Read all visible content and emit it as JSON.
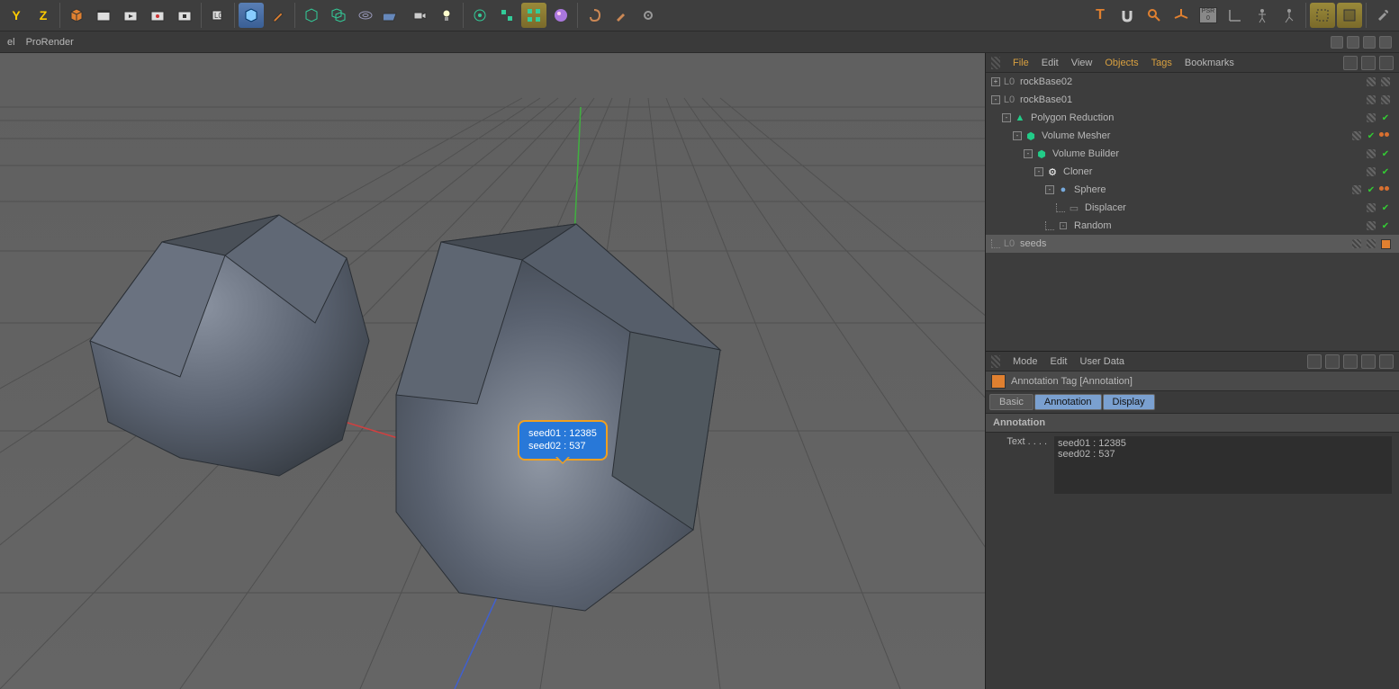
{
  "toolbar": {
    "left_icons": [
      "axis-y-icon",
      "axis-z-icon",
      "cube-icon",
      "clapper-icon",
      "clapper-play-icon",
      "clapper-rec-icon",
      "clapper-stop-icon"
    ],
    "left_icons2": [
      "layer-icon",
      "cube-shaded-icon",
      "pencil-icon",
      "cube-wireframe-add-icon",
      "cube-copy-icon",
      "torus-icon",
      "floor-icon",
      "camera-icon",
      "light-icon"
    ],
    "left_icons3": [
      "atom-icon",
      "cubes-link-icon",
      "cubes-group-icon",
      "sphere-icon",
      "spiral-icon",
      "brush-icon",
      "gear-icon"
    ],
    "right_icons": [
      "text-icon",
      "magnet-icon",
      "search-icon",
      "axis-widget-icon",
      "psr-icon",
      "coords-icon",
      "figure-icon",
      "walk-icon",
      "selection-a-icon",
      "selection-b-icon",
      "wrench-icon"
    ]
  },
  "second_bar": {
    "left": [
      "el",
      "ProRender"
    ]
  },
  "viewport": {
    "annotation": "seed01 : 12385\nseed02 : 537"
  },
  "object_manager": {
    "menu": [
      "File",
      "Edit",
      "View",
      "Objects",
      "Tags",
      "Bookmarks"
    ],
    "menu_active": [
      1,
      0,
      0,
      1,
      1,
      0
    ],
    "tree": [
      {
        "depth": 0,
        "exp": "+",
        "iconColor": "#888",
        "iconText": "L0",
        "label": "rockBase02",
        "tags": [
          "enable",
          "enable"
        ]
      },
      {
        "depth": 0,
        "exp": "-",
        "iconColor": "#888",
        "iconText": "L0",
        "label": "rockBase01",
        "tags": [
          "enable",
          "enable"
        ]
      },
      {
        "depth": 1,
        "exp": "-",
        "iconColor": "#2c8",
        "iconText": "▲",
        "label": "Polygon Reduction",
        "tags": [
          "enable",
          "check"
        ]
      },
      {
        "depth": 2,
        "exp": "-",
        "iconColor": "#2c8",
        "iconText": "⬢",
        "label": "Volume Mesher",
        "tags": [
          "enable",
          "check",
          "double"
        ]
      },
      {
        "depth": 3,
        "exp": "-",
        "iconColor": "#2c8",
        "iconText": "⬢",
        "label": "Volume Builder",
        "tags": [
          "enable",
          "check"
        ]
      },
      {
        "depth": 4,
        "exp": "-",
        "iconColor": "#fff",
        "iconText": "⚙",
        "label": "Cloner",
        "tags": [
          "enable",
          "check"
        ]
      },
      {
        "depth": 5,
        "exp": "-",
        "iconColor": "#7ad",
        "iconText": "●",
        "label": "Sphere",
        "tags": [
          "enable",
          "check",
          "double"
        ]
      },
      {
        "depth": 6,
        "exp": "└",
        "iconColor": "#888",
        "iconText": "▭",
        "label": "Displacer",
        "tags": [
          "enable",
          "check"
        ]
      },
      {
        "depth": 5,
        "exp": "└",
        "iconColor": "#888",
        "iconText": "⚀",
        "label": "Random",
        "tags": [
          "enable",
          "check"
        ]
      },
      {
        "depth": 0,
        "exp": "└",
        "iconColor": "#888",
        "iconText": "L0",
        "label": "seeds",
        "selected": true,
        "tags": [
          "enable",
          "enable",
          "orange"
        ]
      }
    ]
  },
  "attribute_manager": {
    "menu": [
      "Mode",
      "Edit",
      "User Data"
    ],
    "title": "Annotation Tag [Annotation]",
    "tabs": [
      "Basic",
      "Annotation",
      "Display"
    ],
    "active_tabs": [
      1,
      2
    ],
    "section": "Annotation",
    "text_label": "Text . . . .",
    "text_value": "seed01 : 12385\nseed02 : 537"
  }
}
